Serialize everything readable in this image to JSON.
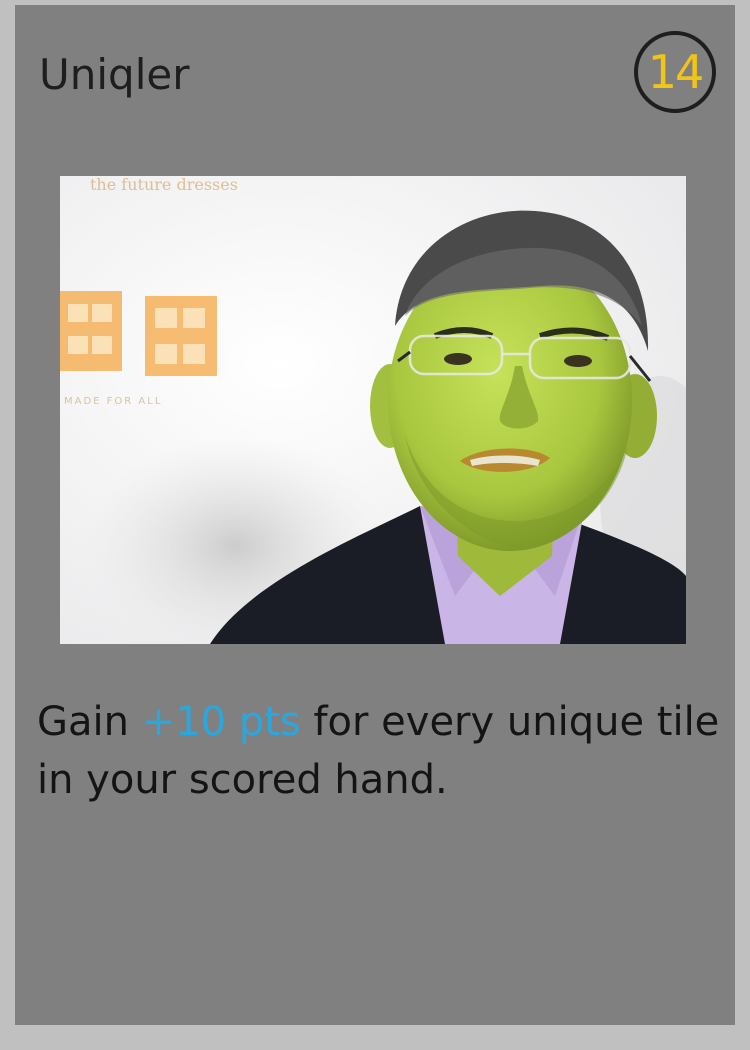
{
  "card": {
    "name": "Uniqler",
    "cost": "14",
    "art_description_icon": "portrait-art",
    "rules": {
      "prefix": "Gain ",
      "highlight": "+10 pts",
      "suffix": " for every unique tile in your scored hand."
    },
    "art_text": {
      "top_banner": "the future dresses",
      "logo_small": "MADE FOR ALL"
    },
    "colors": {
      "background": "#c0c0c0",
      "card": "#808080",
      "cost": "#f0c419",
      "highlight": "#29a8e0",
      "text": "#141414"
    }
  }
}
